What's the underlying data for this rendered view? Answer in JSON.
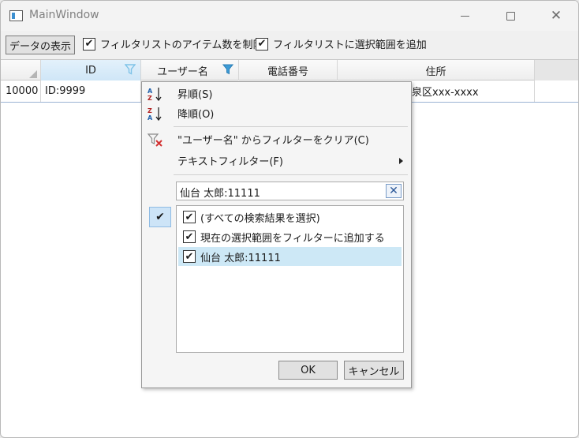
{
  "window": {
    "title": "MainWindow"
  },
  "toolbar": {
    "show_button": "データの表示",
    "limit_items_label": "フィルタリストのアイテム数を制限",
    "limit_items_checked": true,
    "add_selection_label": "フィルタリストに選択範囲を追加",
    "add_selection_checked": true
  },
  "grid": {
    "columns": [
      "ID",
      "ユーザー名",
      "電話番号",
      "住所"
    ],
    "rows": [
      {
        "row_header": "10000",
        "id": "ID:9999",
        "address": "泉区xxx-xxxx"
      }
    ]
  },
  "filter_popup": {
    "menu": {
      "sort_asc": "昇順(S)",
      "sort_desc": "降順(O)",
      "clear_filter": "\"ユーザー名\" からフィルターをクリア(C)",
      "text_filter": "テキストフィルター(F)"
    },
    "search_value": "仙台 太郎:11111",
    "list_items": [
      {
        "label": "(すべての検索結果を選択)",
        "checked": true
      },
      {
        "label": "現在の選択範囲をフィルターに追加する",
        "checked": true
      },
      {
        "label": "仙台 太郎:11111",
        "checked": true,
        "selected": true
      }
    ],
    "ok_label": "OK",
    "cancel_label": "キャンセル"
  },
  "colors": {
    "filter_icon_active": "#3d9bd6",
    "filter_icon_idle": "#7fc3e8",
    "selection": "#cde8f6"
  },
  "icons": {
    "check": "✔",
    "close": "✕",
    "clear_x": "✕"
  }
}
